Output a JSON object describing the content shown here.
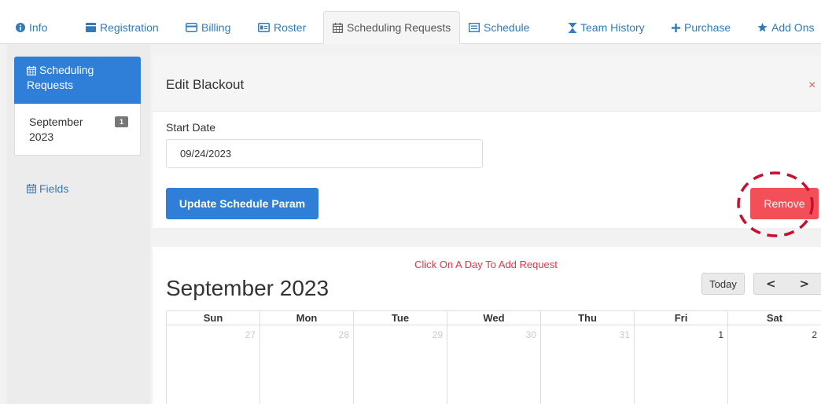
{
  "tabs": [
    {
      "label": "Info",
      "icon": "info-circle-icon",
      "active": false
    },
    {
      "label": "Registration",
      "icon": "clipboard-icon",
      "active": false
    },
    {
      "label": "Billing",
      "icon": "credit-card-icon",
      "active": false
    },
    {
      "label": "Roster",
      "icon": "id-card-icon",
      "active": false
    },
    {
      "label": "Scheduling Requests",
      "icon": "calendar-icon",
      "active": true
    },
    {
      "label": "Schedule",
      "icon": "list-icon",
      "active": false
    },
    {
      "label": "Team History",
      "icon": "hourglass-icon",
      "active": false
    },
    {
      "label": "Purchase",
      "icon": "plus-icon",
      "active": false
    },
    {
      "label": "Add Ons",
      "icon": "star-icon",
      "active": false
    }
  ],
  "sidebar": {
    "active_line1": "Scheduling",
    "active_line2": "Requests",
    "sub_line1": "September",
    "sub_line2": "2023",
    "sub_badge": "1",
    "fields_label": "Fields"
  },
  "blackout": {
    "title": "Edit Blackout",
    "close": "×",
    "start_label": "Start Date",
    "start_value": "09/24/2023",
    "update_button": "Update Schedule Param",
    "remove_button": "Remove"
  },
  "calendar": {
    "hint": "Click On A Day To Add Request",
    "title": "September 2023",
    "today_button": "Today",
    "prev": "<",
    "next": ">",
    "weekdays": [
      "Sun",
      "Mon",
      "Tue",
      "Wed",
      "Thu",
      "Fri",
      "Sat"
    ],
    "days": [
      "27",
      "28",
      "29",
      "30",
      "31",
      "1",
      "2"
    ],
    "accent_color": "#2f7fd8",
    "danger_color": "#f24f58"
  }
}
